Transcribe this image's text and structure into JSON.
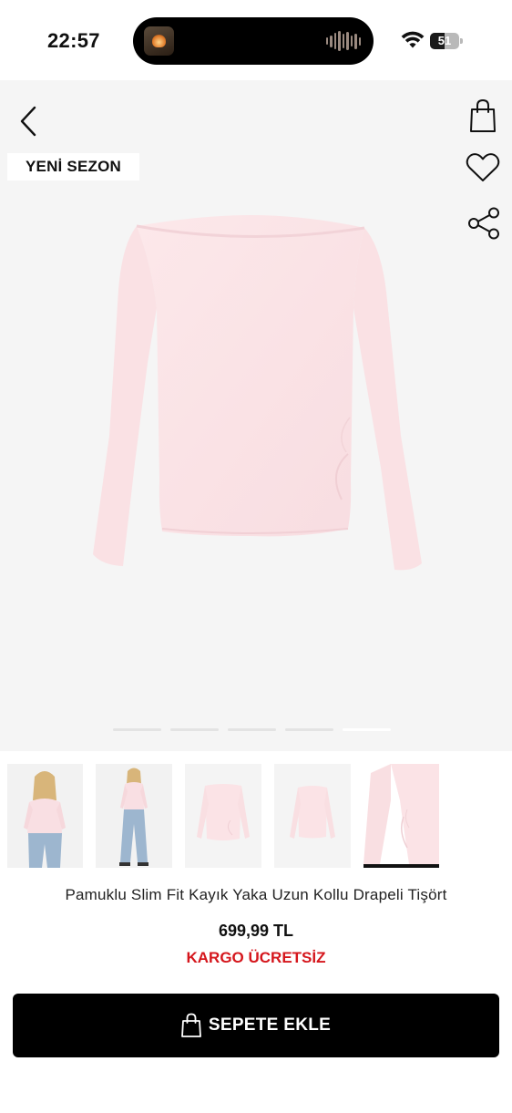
{
  "status_bar": {
    "time": "22:57",
    "battery_percent": "51",
    "battery_level": 0.51
  },
  "product": {
    "badge": "YENİ SEZON",
    "title": "Pamuklu Slim Fit Kayık Yaka Uzun Kollu Drapeli Tişört",
    "price": "699,99 TL",
    "shipping": "KARGO ÜCRETSİZ",
    "image_count": 5,
    "active_image_index": 4,
    "thumbnails": [
      {
        "type": "model-front"
      },
      {
        "type": "model-full"
      },
      {
        "type": "flat-front"
      },
      {
        "type": "flat-back"
      },
      {
        "type": "detail-closeup"
      }
    ]
  },
  "actions": {
    "add_to_cart_label": "SEPETE EKLE"
  },
  "icons": {
    "back": "chevron-left-icon",
    "cart": "shopping-bag-icon",
    "favorite": "heart-icon",
    "share": "share-icon"
  },
  "colors": {
    "accent_red": "#d5161c",
    "cta_background": "#000000",
    "garment_pink": "#fbe3e6",
    "image_background": "#f5f5f5"
  }
}
